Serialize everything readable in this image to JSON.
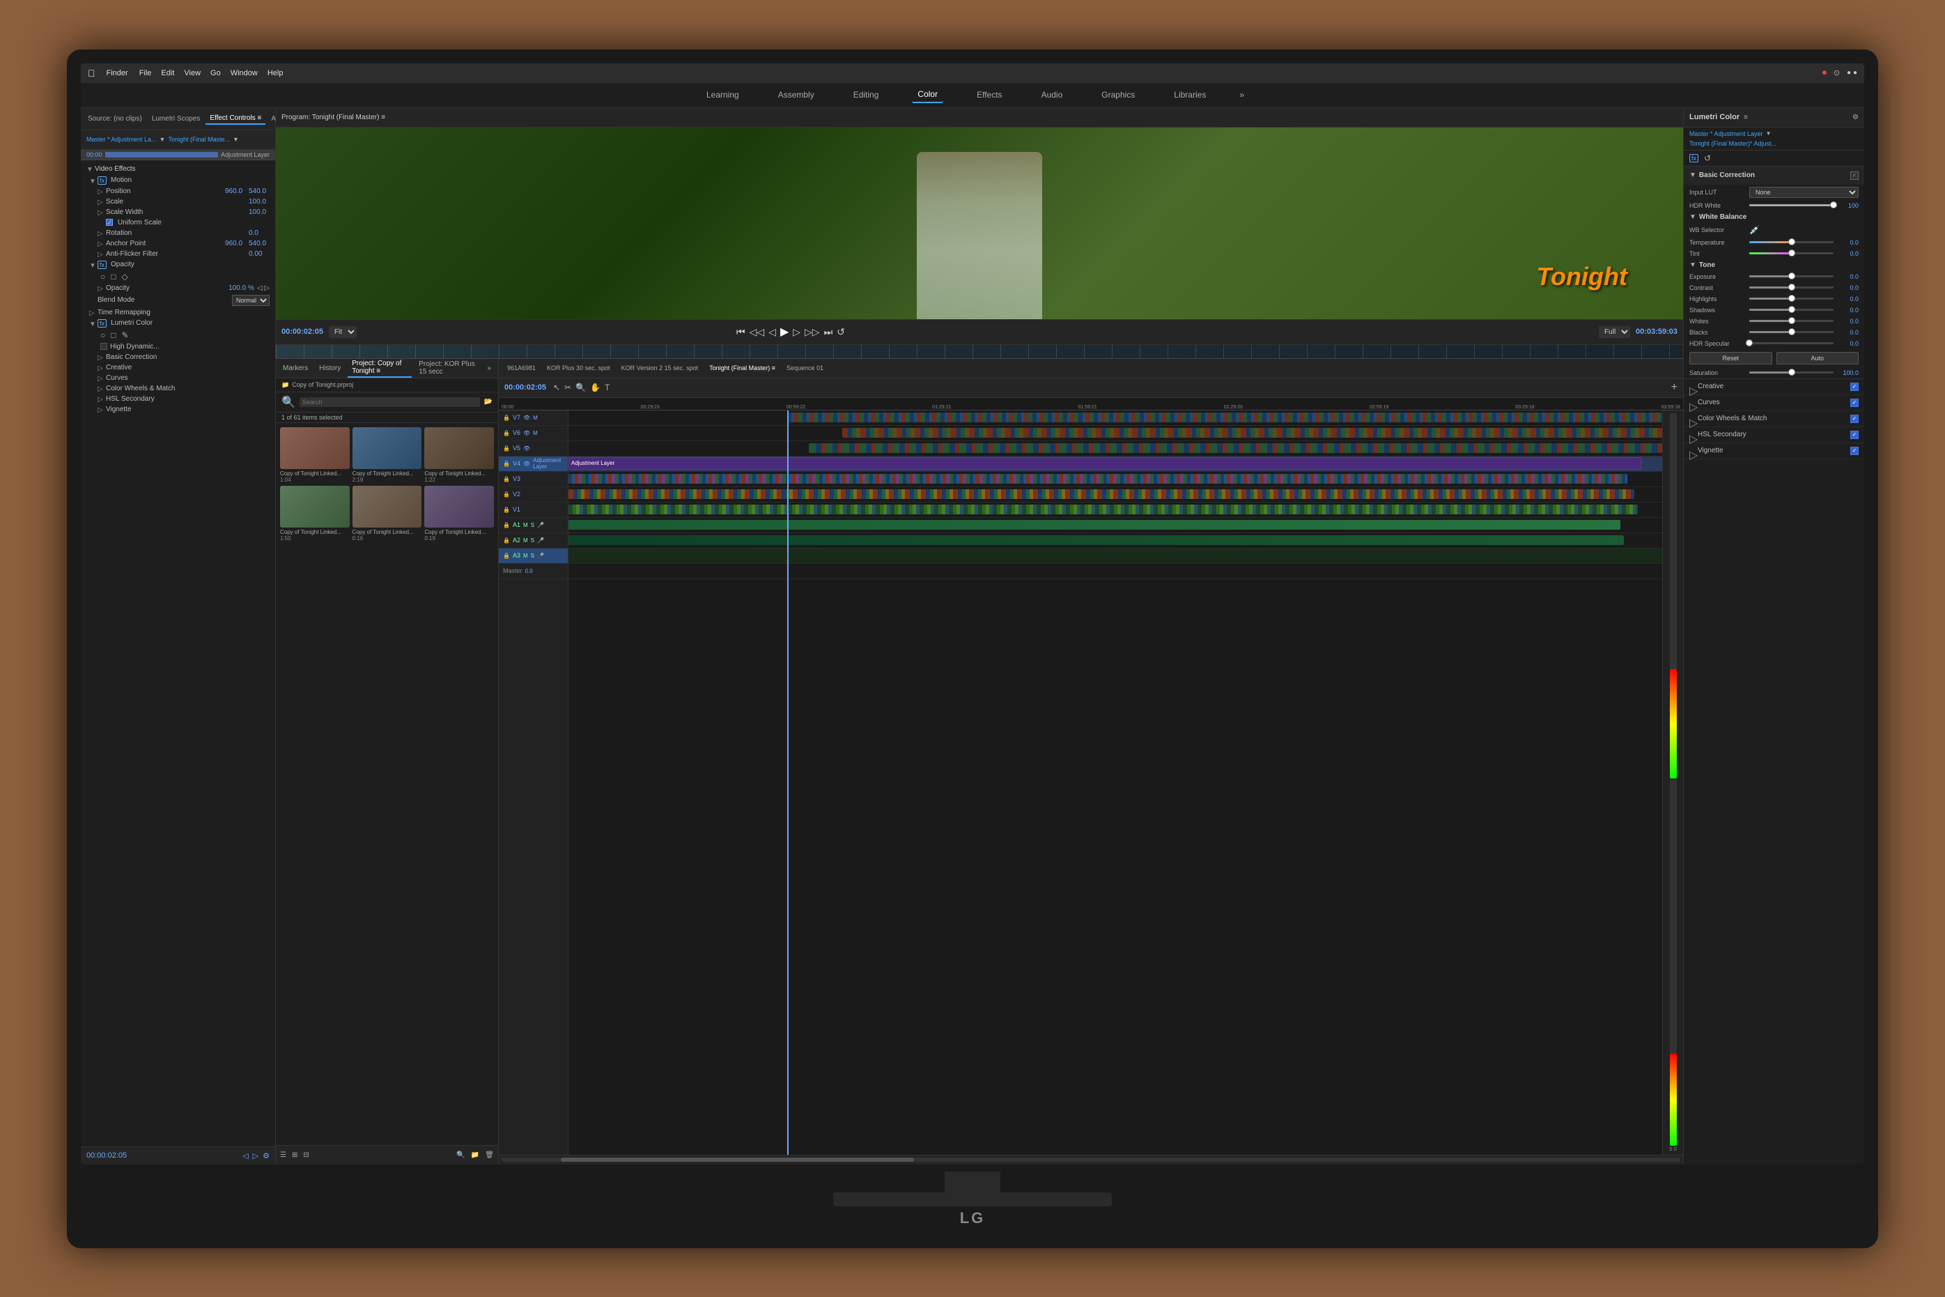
{
  "monitor": {
    "brand": "LG"
  },
  "mac_menubar": {
    "app_name": "Finder",
    "menus": [
      "File",
      "Edit",
      "View",
      "Go",
      "Window",
      "Help"
    ]
  },
  "workspaces": {
    "tabs": [
      "Learning",
      "Assembly",
      "Editing",
      "Color",
      "Effects",
      "Audio",
      "Graphics",
      "Libraries"
    ],
    "active": "Color",
    "more": "»"
  },
  "effect_controls": {
    "panel_title": "Effect Controls",
    "tabs": [
      "Source: (no clips)",
      "Lumetri Scopes",
      "Effect Controls ≡",
      "Audio Clip Mixer: To",
      "»"
    ],
    "active_tab": "Effect Controls ≡",
    "layer1": "Master * Adjustment La...",
    "layer2": "Tonight (Final Maste...",
    "timecode": "00:00",
    "adjustment_layer_label": "Adjustment Layer",
    "sections": {
      "video_effects": "Video Effects",
      "motion": {
        "name": "Motion",
        "fx_badge": "fx",
        "properties": [
          {
            "name": "Position",
            "val1": "960.0",
            "val2": "540.0"
          },
          {
            "name": "Scale",
            "val1": "100.0",
            "val2": ""
          },
          {
            "name": "Scale Width",
            "val1": "100.0",
            "val2": ""
          },
          {
            "name": "Uniform Scale",
            "type": "checkbox"
          },
          {
            "name": "Rotation",
            "val1": "0.0",
            "val2": ""
          },
          {
            "name": "Anchor Point",
            "val1": "960.0",
            "val2": "540.0"
          },
          {
            "name": "Anti-flicker Filter",
            "val1": "0.00",
            "val2": ""
          }
        ]
      },
      "opacity": {
        "name": "Opacity",
        "fx_badge": "fx",
        "properties": [
          {
            "name": "Opacity",
            "val1": "100.0 %"
          },
          {
            "name": "Blend Mode",
            "val1": "Normal"
          }
        ]
      },
      "time_remapping": {
        "name": "Time Remapping"
      },
      "lumetri_color": {
        "name": "Lumetri Color",
        "fx_badge": "fx",
        "high_dynamic": "High Dynamic...",
        "sub_sections": [
          "Basic Correction",
          "Creative",
          "Curves",
          "Color Wheels & Match",
          "HSL Secondary",
          "Vignette"
        ]
      }
    },
    "bottom_timecode": "00:00:02:05"
  },
  "program_monitor": {
    "title": "Program: Tonight (Final Master) ≡",
    "timecode_in": "00:00:02:05",
    "timecode_out": "00:03:59:03",
    "fit": "Fit",
    "quality": "Full",
    "video_text": "Tonight"
  },
  "project_panel": {
    "tabs": [
      "Markers",
      "History",
      "Project: Copy of Tonight ≡",
      "Project: KOR Plus 15 secc",
      "»"
    ],
    "active_tab": "Project: Copy of Tonight ≡",
    "project_file": "Copy of Tonight.prproj",
    "selected_info": "1 of 61 items selected",
    "thumbnails": [
      {
        "label": "Copy of Tonight Linked...",
        "duration": "1:04",
        "color": "1"
      },
      {
        "label": "Copy of Tonight Linked...",
        "duration": "2:19",
        "color": "2"
      },
      {
        "label": "Copy of Tonight Linked...",
        "duration": "1:22",
        "color": "3"
      },
      {
        "label": "Copy of Tonight Linked...",
        "duration": "1:50",
        "color": "4"
      },
      {
        "label": "Copy of Tonight Linked...",
        "duration": "0:16",
        "color": "5"
      },
      {
        "label": "Copy of Tonight Linked...",
        "duration": "0:19",
        "color": "6"
      }
    ]
  },
  "timeline": {
    "tabs": [
      "961A6981",
      "KOR Plus 30 sec. spot",
      "KOR Version 2 15 sec. spot",
      "Tonight (Final Master) ≡",
      "Sequence 01"
    ],
    "active_tab": "Tonight (Final Master) ≡",
    "timecode": "00:00:02:05",
    "timecodes": [
      "00:00",
      "00:00:29:23",
      "00:00:59:22",
      "00:01:29:21",
      "00:01:59:21",
      "00:02:29:20",
      "00:02:59:19",
      "00:03:29:18",
      "00:03:59:18"
    ],
    "tracks": [
      {
        "label": "V7",
        "type": "video"
      },
      {
        "label": "V6",
        "type": "video"
      },
      {
        "label": "V5",
        "type": "video"
      },
      {
        "label": "V4",
        "type": "video"
      },
      {
        "label": "V3",
        "type": "video"
      },
      {
        "label": "V2",
        "type": "video"
      },
      {
        "label": "V1",
        "type": "video",
        "clip": "Adjustment Layer"
      },
      {
        "label": "A1",
        "type": "audio"
      },
      {
        "label": "A2",
        "type": "audio"
      },
      {
        "label": "A3",
        "type": "audio",
        "selected": true
      },
      {
        "label": "Master",
        "type": "master",
        "value": "0.0"
      }
    ]
  },
  "lumetri_color": {
    "panel_title": "Lumetri Color",
    "master_label": "Master * Adjustment Layer",
    "sequence_label": "Tonight (Final Master)* Adjust...",
    "fx_badge": "fx",
    "basic_correction": {
      "title": "Basic Correction",
      "input_lut_label": "Input LUT",
      "input_lut_value": "None",
      "hdr_white_label": "HDR White",
      "hdr_white_value": "100",
      "white_balance": {
        "title": "White Balance",
        "wb_selector": "WB Selector",
        "temperature_label": "Temperature",
        "temperature_value": "0.0",
        "tint_label": "Tint",
        "tint_value": "0.0"
      },
      "tone": {
        "title": "Tone",
        "exposure_label": "Exposure",
        "exposure_value": "0.0",
        "contrast_label": "Contrast",
        "contrast_value": "0.0",
        "highlights_label": "Highlights",
        "highlights_value": "0.0",
        "shadows_label": "Shadows",
        "shadows_value": "0.0",
        "whites_label": "Whites",
        "whites_value": "0.0",
        "blacks_label": "Blacks",
        "blacks_value": "0.0",
        "hdr_specular_label": "HDR Specular",
        "hdr_specular_value": "0.0"
      },
      "reset_label": "Reset",
      "auto_label": "Auto",
      "saturation_label": "Saturation",
      "saturation_value": "100.0"
    },
    "sections": [
      {
        "name": "Creative",
        "enabled": true
      },
      {
        "name": "Curves",
        "enabled": true
      },
      {
        "name": "Color Wheels & Match",
        "enabled": true
      },
      {
        "name": "HSL Secondary",
        "enabled": true
      },
      {
        "name": "Vignette",
        "enabled": true
      }
    ]
  }
}
